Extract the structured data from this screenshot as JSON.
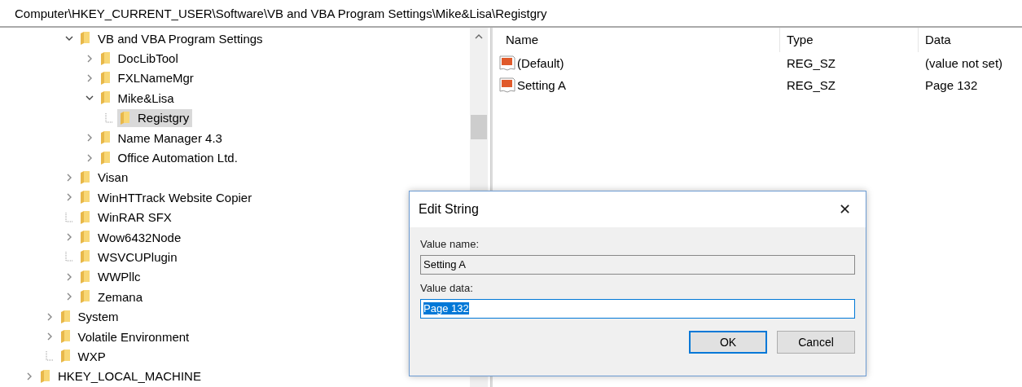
{
  "address_bar": {
    "path": "Computer\\HKEY_CURRENT_USER\\Software\\VB and VBA Program Settings\\Mike&Lisa\\Registgry"
  },
  "tree": [
    {
      "children": [
        {
          "children": [
            {
              "label": "VB and VBA Program Settings",
              "kind": "branch",
              "expanded": true,
              "selected": false,
              "children": [
                {
                  "label": "DocLibTool",
                  "kind": "branch",
                  "expanded": false,
                  "selected": false
                },
                {
                  "label": "FXLNameMgr",
                  "kind": "branch",
                  "expanded": false,
                  "selected": false
                },
                {
                  "label": "Mike&Lisa",
                  "kind": "branch",
                  "expanded": true,
                  "selected": false,
                  "children": [
                    {
                      "label": "Registgry",
                      "kind": "leaf",
                      "selected": true
                    }
                  ]
                },
                {
                  "label": "Name Manager 4.3",
                  "kind": "branch",
                  "expanded": false,
                  "selected": false
                },
                {
                  "label": "Office Automation Ltd.",
                  "kind": "branch",
                  "expanded": false,
                  "selected": false
                }
              ]
            },
            {
              "label": "Visan",
              "kind": "branch",
              "expanded": false,
              "selected": false
            },
            {
              "label": "WinHTTrack Website Copier",
              "kind": "branch",
              "expanded": false,
              "selected": false
            },
            {
              "label": "WinRAR SFX",
              "kind": "leaf",
              "selected": false
            },
            {
              "label": "Wow6432Node",
              "kind": "branch",
              "expanded": false,
              "selected": false
            },
            {
              "label": "WSVCUPlugin",
              "kind": "leaf",
              "selected": false
            },
            {
              "label": "WWPllc",
              "kind": "branch",
              "expanded": false,
              "selected": false
            },
            {
              "label": "Zemana",
              "kind": "branch",
              "expanded": false,
              "selected": false
            }
          ]
        },
        {
          "label": "System",
          "kind": "branch",
          "expanded": false,
          "selected": false
        },
        {
          "label": "Volatile Environment",
          "kind": "branch",
          "expanded": false,
          "selected": false
        },
        {
          "label": "WXP",
          "kind": "leaf",
          "selected": false
        }
      ]
    },
    {
      "label": "HKEY_LOCAL_MACHINE",
      "kind": "branch",
      "expanded": false,
      "selected": false
    }
  ],
  "values": {
    "columns": [
      "Name",
      "Type",
      "Data"
    ],
    "rows": [
      {
        "name": "(Default)",
        "type": "REG_SZ",
        "data": "(value not set)"
      },
      {
        "name": "Setting A",
        "type": "REG_SZ",
        "data": "Page 132"
      }
    ]
  },
  "dialog": {
    "title": "Edit String",
    "close": "✕",
    "value_name_label": "Value name:",
    "value_name": "Setting A",
    "value_data_label": "Value data:",
    "value_data": "Page 132",
    "buttons": [
      "OK",
      "Cancel"
    ]
  }
}
